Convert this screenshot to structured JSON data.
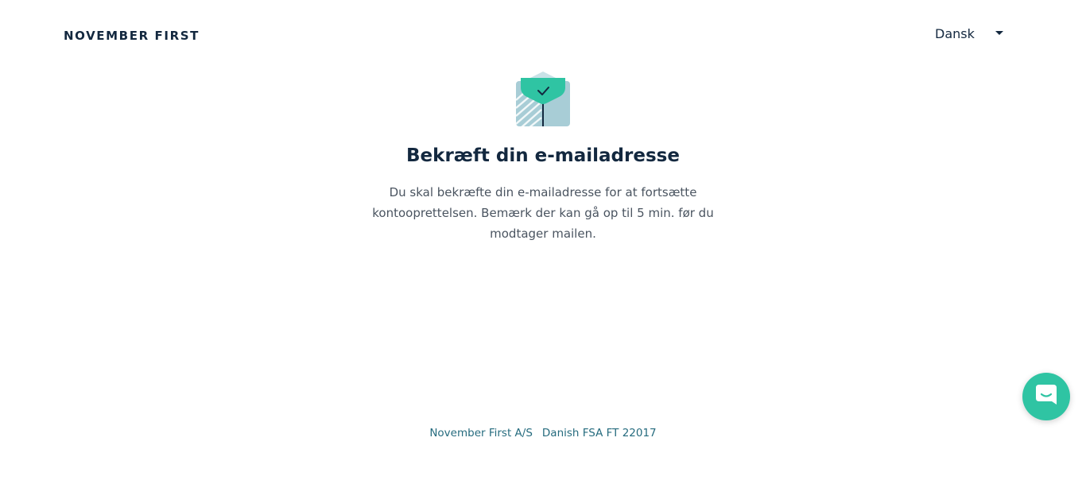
{
  "header": {
    "logo_text": "NOVEMBER FIRST",
    "language_selected": "Dansk"
  },
  "main": {
    "icon": "envelope-check-icon",
    "title": "Bekræft din e-mailadresse",
    "description": "Du skal bekræfte din e-mailadresse for at fortsætte kontooprettelsen. Bemærk der kan gå op til 5 min. før du modtager mailen."
  },
  "footer": {
    "company": "November First A/S",
    "license": "Danish FSA FT 22017"
  },
  "chat": {
    "icon": "chat-icon"
  },
  "colors": {
    "brand_dark": "#13283f",
    "accent_green": "#2fc4a3",
    "envelope_blue": "#a8cdd6",
    "footer_link": "#256b7e"
  }
}
